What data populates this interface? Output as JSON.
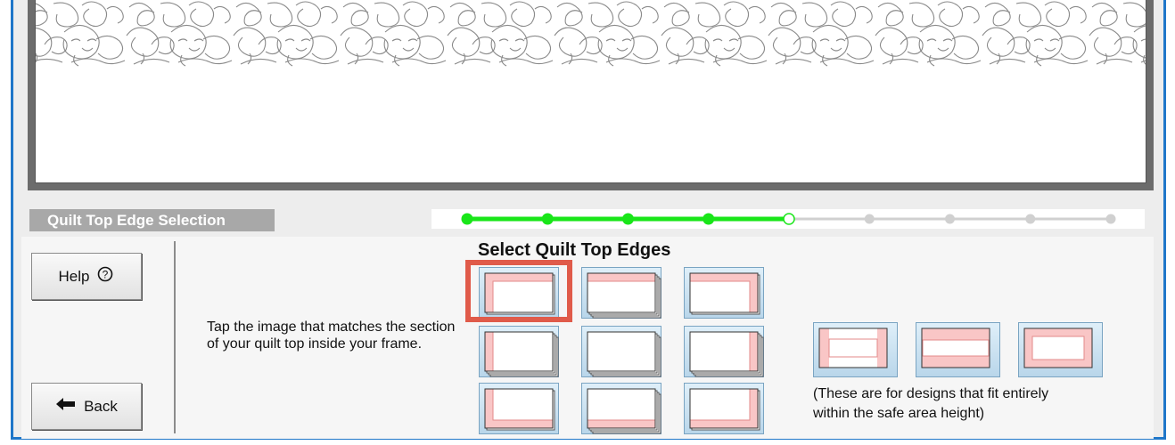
{
  "section_label": "Quilt Top Edge Selection",
  "progress": {
    "total_steps": 9,
    "current_step": 5,
    "completed_steps": 4,
    "active_color": "#19e619",
    "inactive_color": "#d0d0d0"
  },
  "help_button": {
    "label": "Help",
    "icon": "question-circle-icon"
  },
  "back_button": {
    "label": "Back",
    "icon": "left-arrow-icon"
  },
  "instructions": "Tap the image that matches the section of your quilt top inside your frame.",
  "title": "Select Quilt Top Edges",
  "edge_options": [
    [
      "top-left corner",
      "top edge",
      "top-right corner"
    ],
    [
      "left edge",
      "middle",
      "right edge"
    ],
    [
      "bottom-left corner",
      "bottom edge",
      "bottom-right corner"
    ]
  ],
  "safe_area_options": [
    "left-right edges",
    "top-bottom edges",
    "full border"
  ],
  "safe_area_note": "(These are for designs that fit entirely\n within the safe area height)",
  "selected_option": "top-left corner",
  "highlight_color": "#e05b4a"
}
